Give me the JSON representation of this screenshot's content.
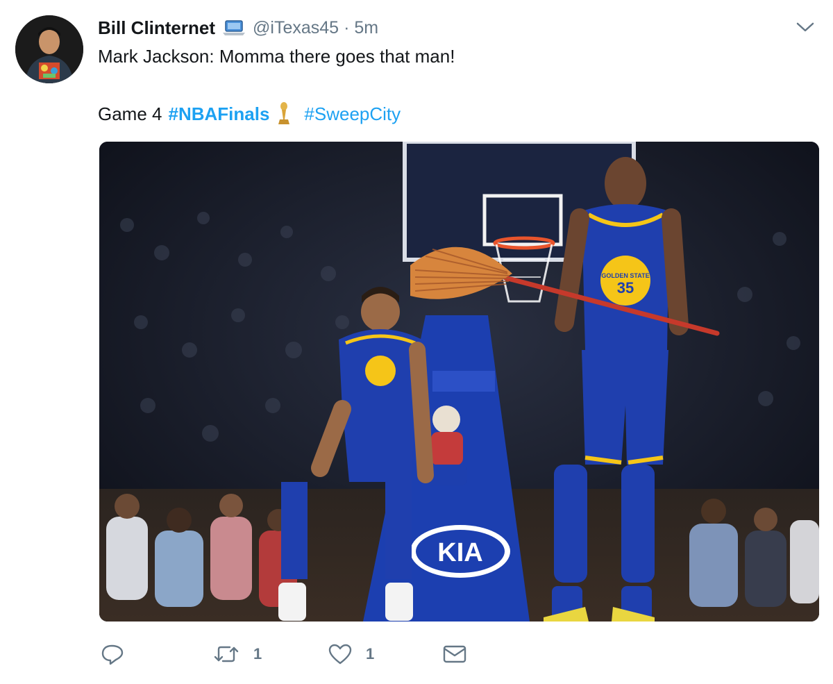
{
  "tweet": {
    "display_name": "Bill Clinternet",
    "handle": "@iTexas45",
    "separator": "·",
    "time_ago": "5m",
    "text_line1": "Mark Jackson: Momma there goes that man!",
    "text_line2_prefix": "Game 4",
    "hashtags": [
      "#NBAFinals",
      "#SweepCity"
    ],
    "name_emoji_icon": "laptop-icon",
    "hashtag_emoji_icon": "trophy-icon",
    "media_ad_text": "KIA",
    "media_jersey_number": "35",
    "media_jersey_text": "GOLDEN STATE"
  },
  "actions": {
    "reply": {
      "icon": "reply-icon"
    },
    "retweet": {
      "icon": "retweet-icon",
      "count": "1"
    },
    "like": {
      "icon": "heart-icon",
      "count": "1"
    },
    "message": {
      "icon": "envelope-icon"
    }
  },
  "colors": {
    "link": "#1da1f2",
    "muted": "#657786",
    "text": "#14171a",
    "jersey_blue": "#1f3fae",
    "jersey_gold": "#f5c518"
  }
}
